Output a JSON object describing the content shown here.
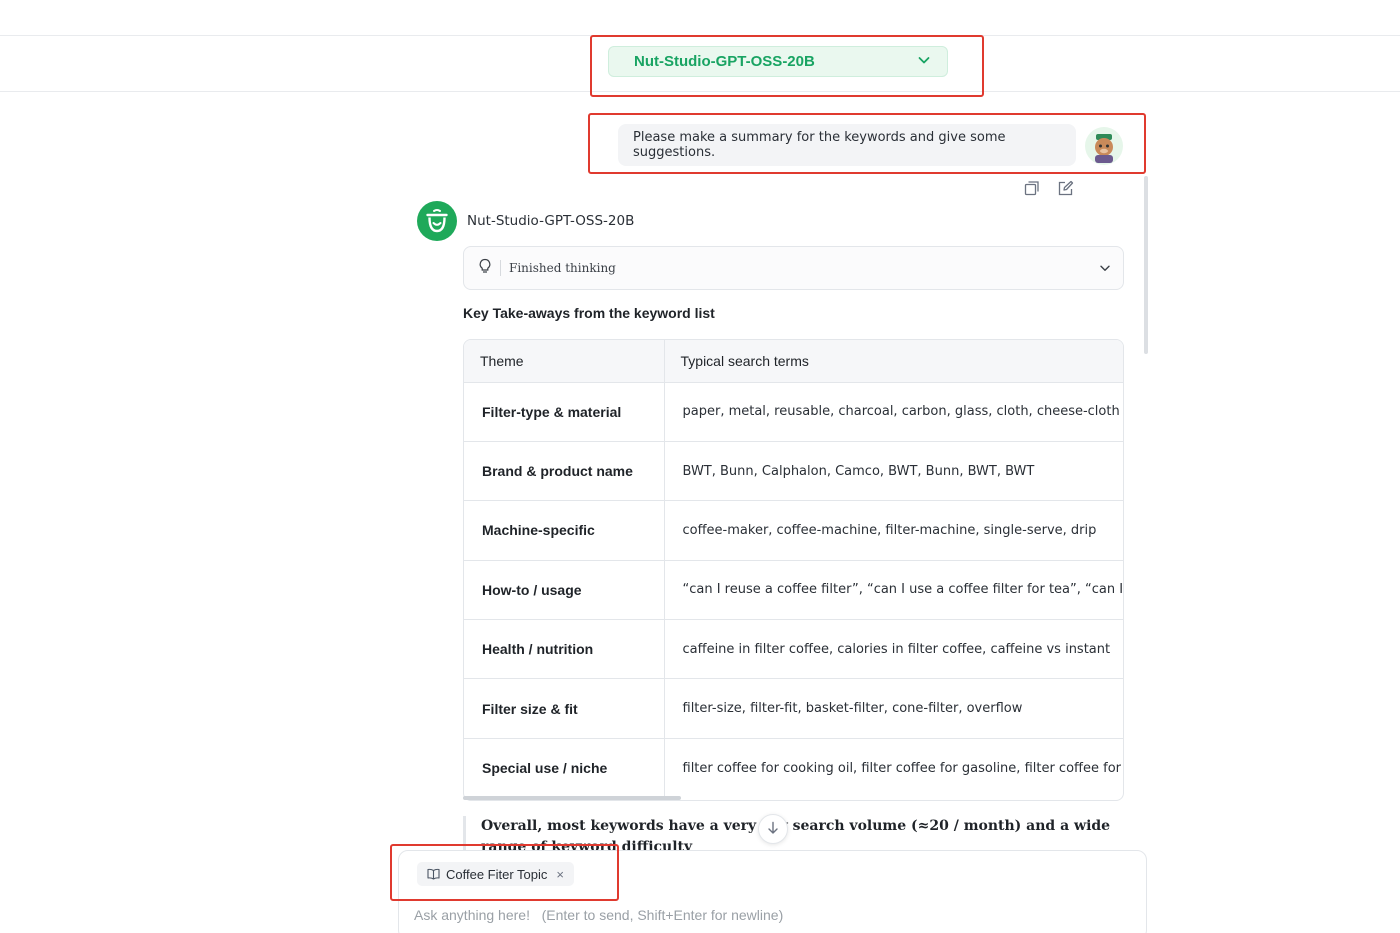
{
  "model_selector": {
    "label": "Nut-Studio-GPT-OSS-20B",
    "accent": "#19a463"
  },
  "user_message": {
    "text": "Please make a summary for the keywords and give some suggestions."
  },
  "assistant": {
    "name": "Nut-Studio-GPT-OSS-20B",
    "thinking_label": "Finished thinking",
    "heading": "Key Take-aways from the keyword list",
    "table": {
      "headers": [
        "Theme",
        "Typical search terms"
      ],
      "rows": [
        {
          "theme": "Filter-type & material",
          "terms": "paper, metal, reusable, charcoal, carbon, glass, cloth, cheese-cloth"
        },
        {
          "theme": "Brand & product name",
          "terms": "BWT, Bunn, Calphalon, Camco, BWT, Bunn, BWT, BWT"
        },
        {
          "theme": "Machine-specific",
          "terms": "coffee-maker, coffee-machine, filter-machine, single-serve, drip"
        },
        {
          "theme": "How-to / usage",
          "terms": "“can I reuse a coffee filter”, “can I use a coffee filter for tea”, “can I use a"
        },
        {
          "theme": "Health / nutrition",
          "terms": "caffeine in filter coffee, calories in filter coffee, caffeine vs instant"
        },
        {
          "theme": "Filter size & fit",
          "terms": "filter-size, filter-fit, basket-filter, cone-filter, overflow"
        },
        {
          "theme": "Special use / niche",
          "terms": "filter coffee for cooking oil, filter coffee for gasoline, filter coffee for join"
        }
      ]
    },
    "summary_line": "Overall, most keywords have a very low search volume (≈20 / month) and a wide range of keyword difficulty"
  },
  "composer": {
    "chip_label": "Coffee Fiter Topic",
    "chip_close": "×",
    "placeholder": "Ask anything here!   (Enter to send, Shift+Enter for newline)"
  },
  "icons": {
    "model_chevron": "chevron-down-icon",
    "copy": "copy-icon",
    "edit": "edit-icon",
    "thinking": "lightbulb-icon",
    "thinking_chevron": "chevron-down-icon",
    "scroll": "arrow-down-icon",
    "chip": "book-icon"
  },
  "highlight_color": "#e03a2f"
}
